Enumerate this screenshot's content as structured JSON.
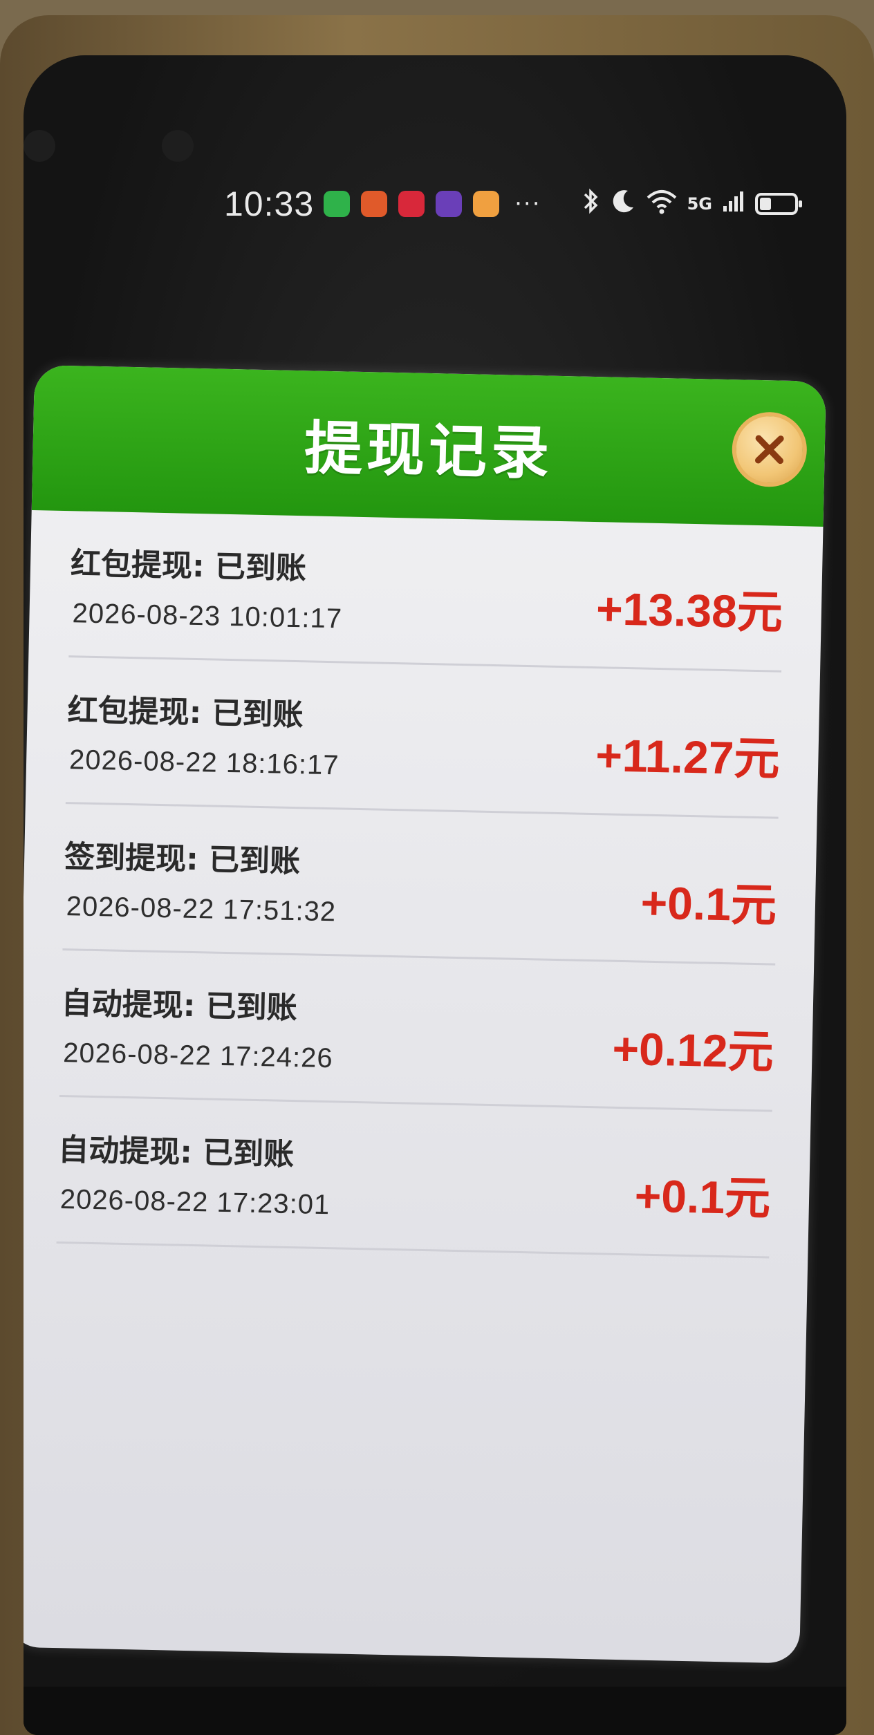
{
  "status_bar": {
    "time": "10:33",
    "app_icons": [
      {
        "name": "wechat-icon",
        "color": "#2fb24a"
      },
      {
        "name": "app-icon-orange",
        "color": "#e05a2a"
      },
      {
        "name": "app-icon-red",
        "color": "#d8283a"
      },
      {
        "name": "app-icon-purple",
        "color": "#6a3fb8"
      },
      {
        "name": "app-icon-yellow",
        "color": "#f0a040"
      }
    ],
    "more_label": "···",
    "network_label": "5G",
    "battery_level": 0.38
  },
  "dialog": {
    "title": "提现记录",
    "header_color": "#2aa414",
    "amount_color": "#d8281b",
    "records": [
      {
        "title": "红包提现: 已到账",
        "time": "2026-08-23 10:01:17",
        "amount": "+13.38元"
      },
      {
        "title": "红包提现: 已到账",
        "time": "2026-08-22 18:16:17",
        "amount": "+11.27元"
      },
      {
        "title": "签到提现: 已到账",
        "time": "2026-08-22 17:51:32",
        "amount": "+0.1元"
      },
      {
        "title": "自动提现: 已到账",
        "time": "2026-08-22 17:24:26",
        "amount": "+0.12元"
      },
      {
        "title": "自动提现: 已到账",
        "time": "2026-08-22 17:23:01",
        "amount": "+0.1元"
      }
    ]
  }
}
